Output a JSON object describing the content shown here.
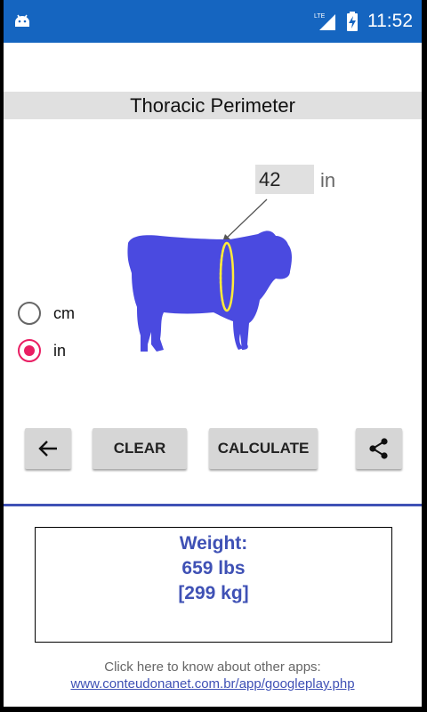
{
  "status_bar": {
    "time": "11:52",
    "network": "LTE",
    "icons": [
      "android-icon",
      "lte-signal-icon",
      "battery-charging-icon"
    ]
  },
  "header": {
    "title": "Thoracic Perimeter"
  },
  "measurement": {
    "value": "42",
    "unit": "in"
  },
  "units": {
    "options": [
      {
        "label": "cm",
        "selected": false
      },
      {
        "label": "in",
        "selected": true
      }
    ]
  },
  "buttons": {
    "back_icon": "arrow-left-icon",
    "clear_label": "CLEAR",
    "calculate_label": "CALCULATE",
    "share_icon": "share-icon"
  },
  "result": {
    "label": "Weight:",
    "lbs": "659 lbs",
    "kg": "[299 kg]"
  },
  "footer": {
    "text": "Click here to know about other apps:",
    "link": "www.conteudonanet.com.br/app/googleplay.php"
  },
  "colors": {
    "status_bar": "#1565c0",
    "accent": "#3f51b5",
    "radio_selected": "#e91e63",
    "cow": "#4a4ae0",
    "girth_line": "#ffeb3b"
  }
}
